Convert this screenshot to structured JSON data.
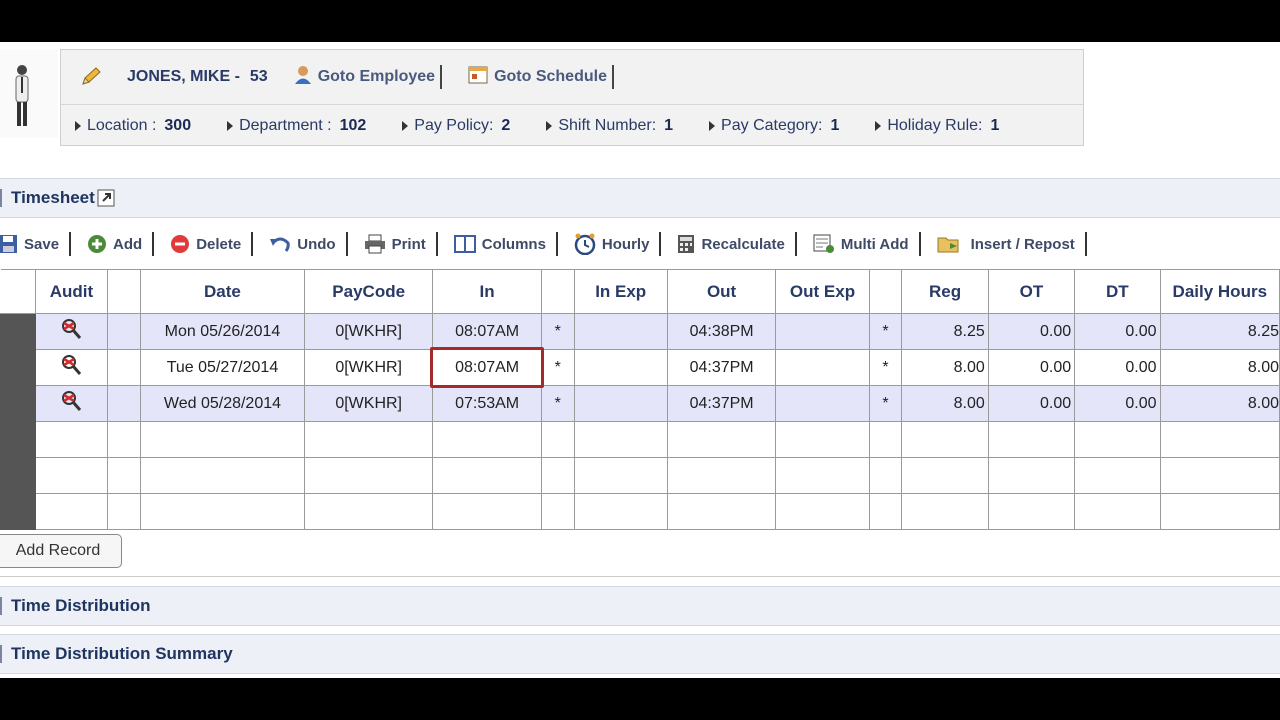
{
  "employee": {
    "name": "JONES, MIKE -",
    "number": "53",
    "goto_employee": "Goto Employee",
    "goto_schedule": "Goto Schedule",
    "attributes": [
      {
        "label": "Location :",
        "value": "300"
      },
      {
        "label": "Department :",
        "value": "102"
      },
      {
        "label": "Pay Policy:",
        "value": "2"
      },
      {
        "label": "Shift Number:",
        "value": "1"
      },
      {
        "label": "Pay Category:",
        "value": "1"
      },
      {
        "label": "Holiday Rule:",
        "value": "1"
      }
    ]
  },
  "timesheet": {
    "title": "Timesheet",
    "toolbar": {
      "save": "Save",
      "add": "Add",
      "delete": "Delete",
      "undo": "Undo",
      "print": "Print",
      "columns": "Columns",
      "hourly": "Hourly",
      "recalculate": "Recalculate",
      "multi_add": "Multi Add",
      "insert_repost": "Insert / Repost"
    },
    "columns": [
      "Audit",
      "Date",
      "PayCode",
      "In",
      "In Exp",
      "Out",
      "Out Exp",
      "Reg",
      "OT",
      "DT",
      "Daily Hours"
    ],
    "rows": [
      {
        "date": "Mon 05/26/2014",
        "paycode": "0[WKHR]",
        "in": "08:07AM",
        "in_flag": "*",
        "in_exp": "",
        "out": "04:38PM",
        "out_exp": "",
        "out_flag": "*",
        "reg": "8.25",
        "ot": "0.00",
        "dt": "0.00",
        "daily": "8.25"
      },
      {
        "date": "Tue 05/27/2014",
        "paycode": "0[WKHR]",
        "in": "08:07AM",
        "in_flag": "*",
        "in_exp": "",
        "out": "04:37PM",
        "out_exp": "",
        "out_flag": "*",
        "reg": "8.00",
        "ot": "0.00",
        "dt": "0.00",
        "daily": "8.00"
      },
      {
        "date": "Wed 05/28/2014",
        "paycode": "0[WKHR]",
        "in": "07:53AM",
        "in_flag": "*",
        "in_exp": "",
        "out": "04:37PM",
        "out_exp": "",
        "out_flag": "*",
        "reg": "8.00",
        "ot": "0.00",
        "dt": "0.00",
        "daily": "8.00"
      }
    ],
    "add_record": "Add Record"
  },
  "sections": {
    "time_distribution": "Time Distribution",
    "time_distribution_summary": "Time Distribution Summary"
  },
  "colors": {
    "alt_row": "#e5e5fa",
    "selected_border": "#a52a2a",
    "header_text": "#2a3a66"
  }
}
